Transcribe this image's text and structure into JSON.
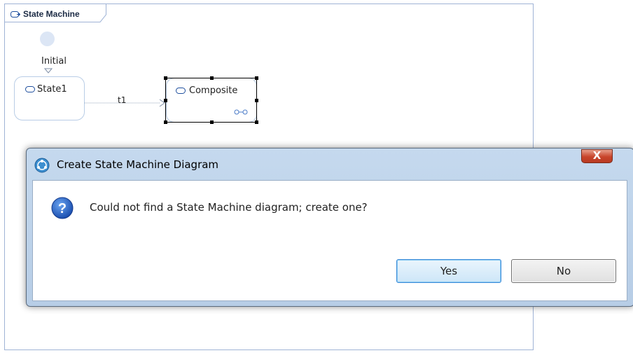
{
  "diagram": {
    "frame_title": "State Machine",
    "initial_label": "Initial",
    "states": [
      {
        "label": "State1"
      },
      {
        "label": "Composite"
      }
    ],
    "transition_label": "t1"
  },
  "dialog": {
    "title": "Create State Machine Diagram",
    "message": "Could not find a State Machine diagram; create one?",
    "close_label": "X",
    "yes_label": "Yes",
    "no_label": "No"
  },
  "colors": {
    "canvas_border": "#9fb3d6",
    "state_border": "#b9cde6",
    "dialog_frame": "#c5d9ee",
    "close_button": "#c8452b",
    "default_button_border": "#3c8ad8"
  },
  "icons": [
    "state-machine-icon",
    "state-icon",
    "composite-icon",
    "app-icon",
    "question-icon",
    "close-icon"
  ]
}
